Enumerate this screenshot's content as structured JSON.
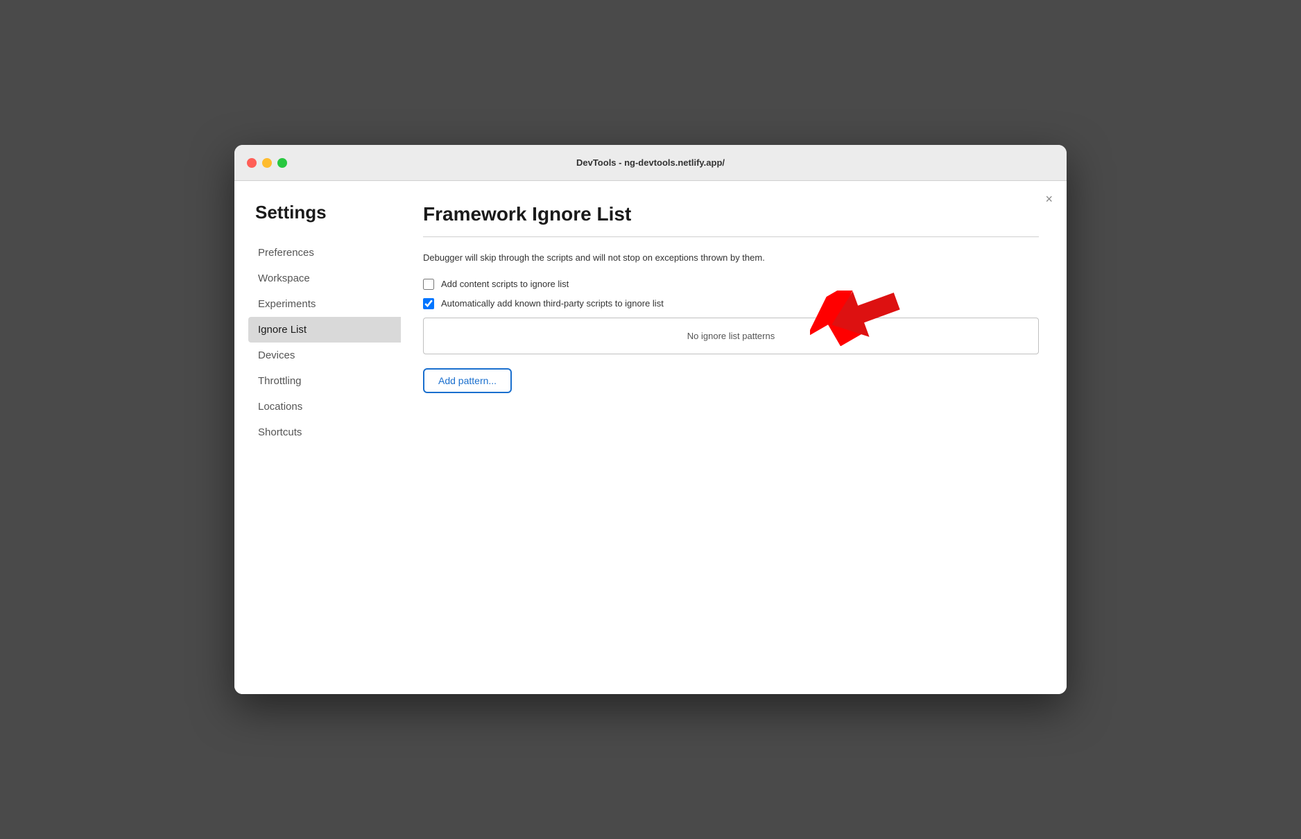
{
  "window": {
    "title": "DevTools - ng-devtools.netlify.app/"
  },
  "sidebar": {
    "heading": "Settings",
    "items": [
      {
        "id": "preferences",
        "label": "Preferences",
        "active": false
      },
      {
        "id": "workspace",
        "label": "Workspace",
        "active": false
      },
      {
        "id": "experiments",
        "label": "Experiments",
        "active": false
      },
      {
        "id": "ignore-list",
        "label": "Ignore List",
        "active": true
      },
      {
        "id": "devices",
        "label": "Devices",
        "active": false
      },
      {
        "id": "throttling",
        "label": "Throttling",
        "active": false
      },
      {
        "id": "locations",
        "label": "Locations",
        "active": false
      },
      {
        "id": "shortcuts",
        "label": "Shortcuts",
        "active": false
      }
    ]
  },
  "main": {
    "title": "Framework Ignore List",
    "description": "Debugger will skip through the scripts and will not stop on exceptions thrown by them.",
    "checkboxes": [
      {
        "id": "add-content-scripts",
        "label": "Add content scripts to ignore list",
        "checked": false
      },
      {
        "id": "auto-add-third-party",
        "label": "Automatically add known third-party scripts to ignore list",
        "checked": true
      }
    ],
    "no_patterns_label": "No ignore list patterns",
    "add_pattern_label": "Add pattern...",
    "close_label": "×"
  }
}
